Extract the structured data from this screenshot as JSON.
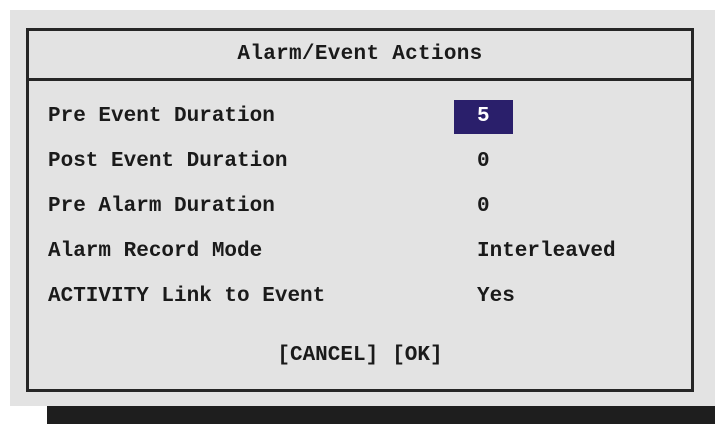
{
  "dialog": {
    "title": "Alarm/Event Actions",
    "fields": [
      {
        "label": "Pre Event Duration",
        "value": "5",
        "selected": true
      },
      {
        "label": "Post Event Duration",
        "value": "0",
        "selected": false
      },
      {
        "label": "Pre Alarm Duration",
        "value": "0",
        "selected": false
      },
      {
        "label": "Alarm Record Mode",
        "value": "Interleaved",
        "selected": false
      },
      {
        "label": "ACTIVITY Link to Event",
        "value": "Yes",
        "selected": false
      }
    ],
    "buttons": {
      "cancel": "[CANCEL]",
      "ok": "[OK]"
    }
  },
  "colors": {
    "panel_bg": "#e3e3e3",
    "border": "#262626",
    "selection_bg": "#2a1f6b",
    "selection_fg": "#ffffff",
    "shadow": "#1e1e1e"
  }
}
